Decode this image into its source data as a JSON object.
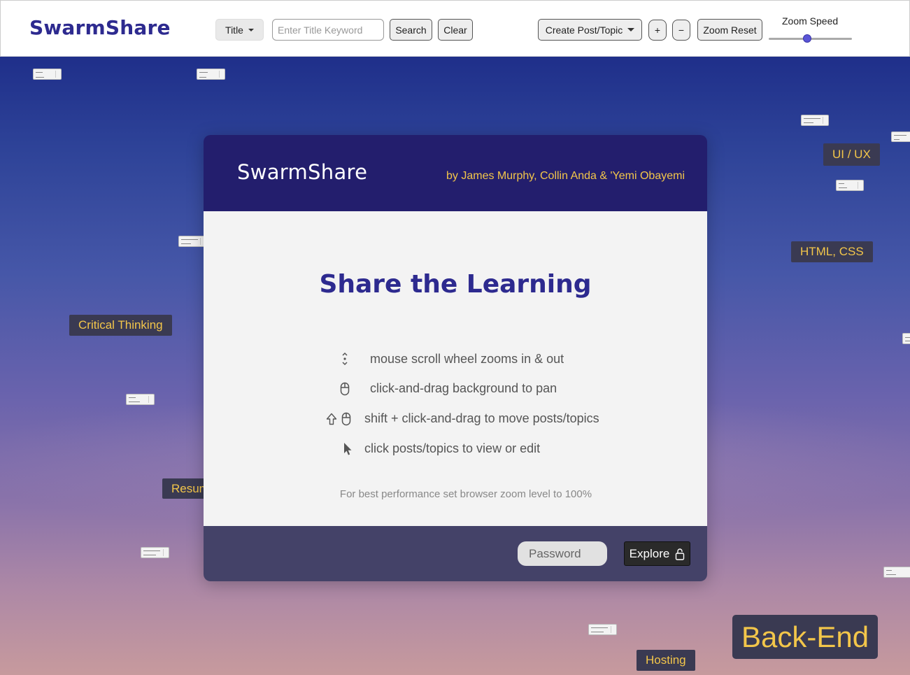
{
  "navbar": {
    "brand": "SwarmShare",
    "filter_select": "Title",
    "search": {
      "placeholder": "Enter Title Keyword",
      "value": ""
    },
    "search_label": "Search",
    "clear_label": "Clear",
    "create_label": "Create Post/Topic",
    "zoom_in_label": "+",
    "zoom_out_label": "−",
    "zoom_reset_label": "Zoom Reset",
    "zoom_speed_label": "Zoom Speed",
    "zoom_speed_value": 0.45
  },
  "canvas": {
    "topics": [
      "UI / UX",
      "HTML, CSS",
      "Critical Thinking",
      "Resum",
      "Back-End",
      "Hosting"
    ]
  },
  "modal": {
    "brand": "SwarmShare",
    "authors": "by James Murphy, Collin Anda & 'Yemi Obayemi",
    "title": "Share the Learning",
    "tips": [
      "mouse scroll wheel zooms in & out",
      "click-and-drag background to pan",
      "shift + click-and-drag to move posts/topics",
      "click posts/topics to view or edit"
    ],
    "note": "For best performance set browser zoom level to 100%",
    "password_placeholder": "Password",
    "explore_label": "Explore"
  },
  "colors": {
    "brand_purple": "#2d2a8f",
    "header_navy": "#231e6d",
    "footer_slate": "#444268",
    "topic_gold": "#f3c64a"
  }
}
